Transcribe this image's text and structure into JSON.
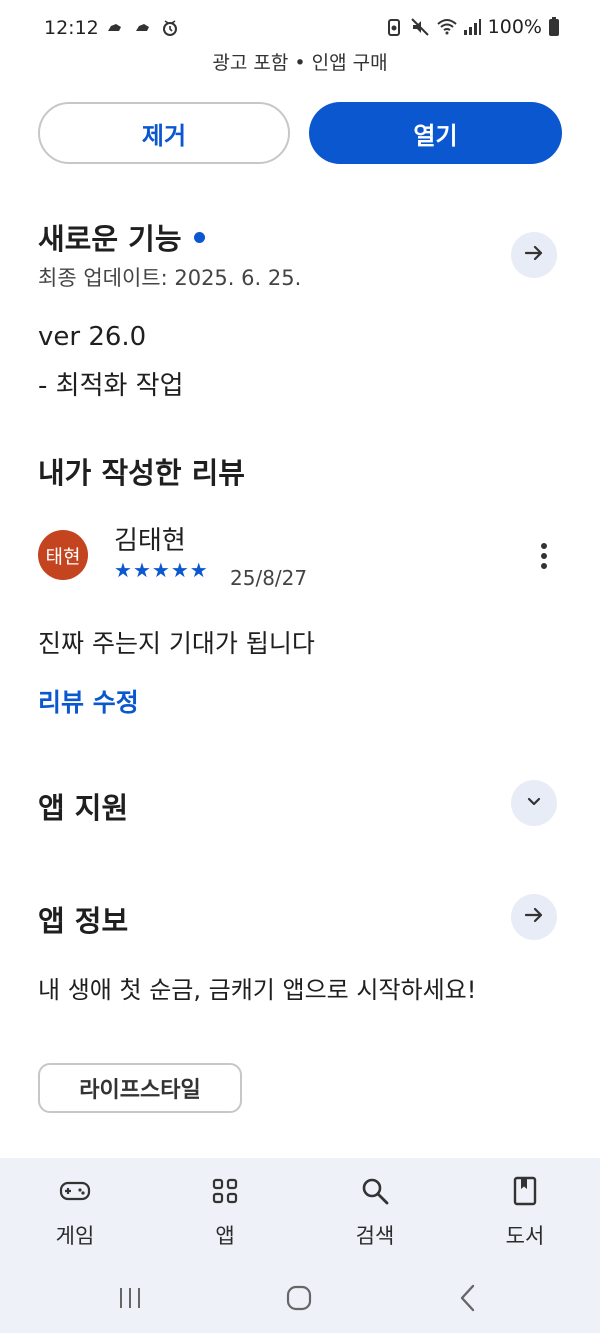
{
  "status_bar": {
    "time": "12:12",
    "battery_percent": "100%",
    "icons_left": [
      "cloud-icon",
      "cloud-icon",
      "alarm-icon"
    ],
    "icons_right": [
      "battery-saver-icon",
      "mute-icon",
      "wifi-icon",
      "signal-icon",
      "battery-icon"
    ]
  },
  "purchase_note": "광고 포함 • 인앱 구매",
  "actions": {
    "remove_label": "제거",
    "open_label": "열기"
  },
  "whats_new": {
    "title": "새로운 기능",
    "updated": "최종 업데이트: 2025. 6. 25.",
    "version": "ver 26.0",
    "notes": "- 최적화 작업"
  },
  "my_review": {
    "title": "내가 작성한 리뷰",
    "avatar_text": "태현",
    "reviewer": "김태현",
    "rating": 5,
    "stars": [
      "★",
      "★",
      "★",
      "★",
      "★"
    ],
    "date": "25/8/27",
    "text": "진짜 주는지 기대가 됩니다",
    "edit_label": "리뷰 수정"
  },
  "app_support": {
    "title": "앱 지원"
  },
  "app_info": {
    "title": "앱 정보",
    "description": "내 생애 첫 순금, 금캐기 앱으로 시작하세요!",
    "category": "라이프스타일"
  },
  "bottom_nav": {
    "items": [
      {
        "label": "게임",
        "icon": "gamepad-icon"
      },
      {
        "label": "앱",
        "icon": "apps-grid-icon"
      },
      {
        "label": "검색",
        "icon": "search-icon"
      },
      {
        "label": "도서",
        "icon": "book-icon"
      }
    ]
  },
  "colors": {
    "accent": "#0b57d0",
    "avatar": "#c3441e",
    "nav_background": "#eef1f8",
    "arrow_button": "#e8ecf6"
  }
}
